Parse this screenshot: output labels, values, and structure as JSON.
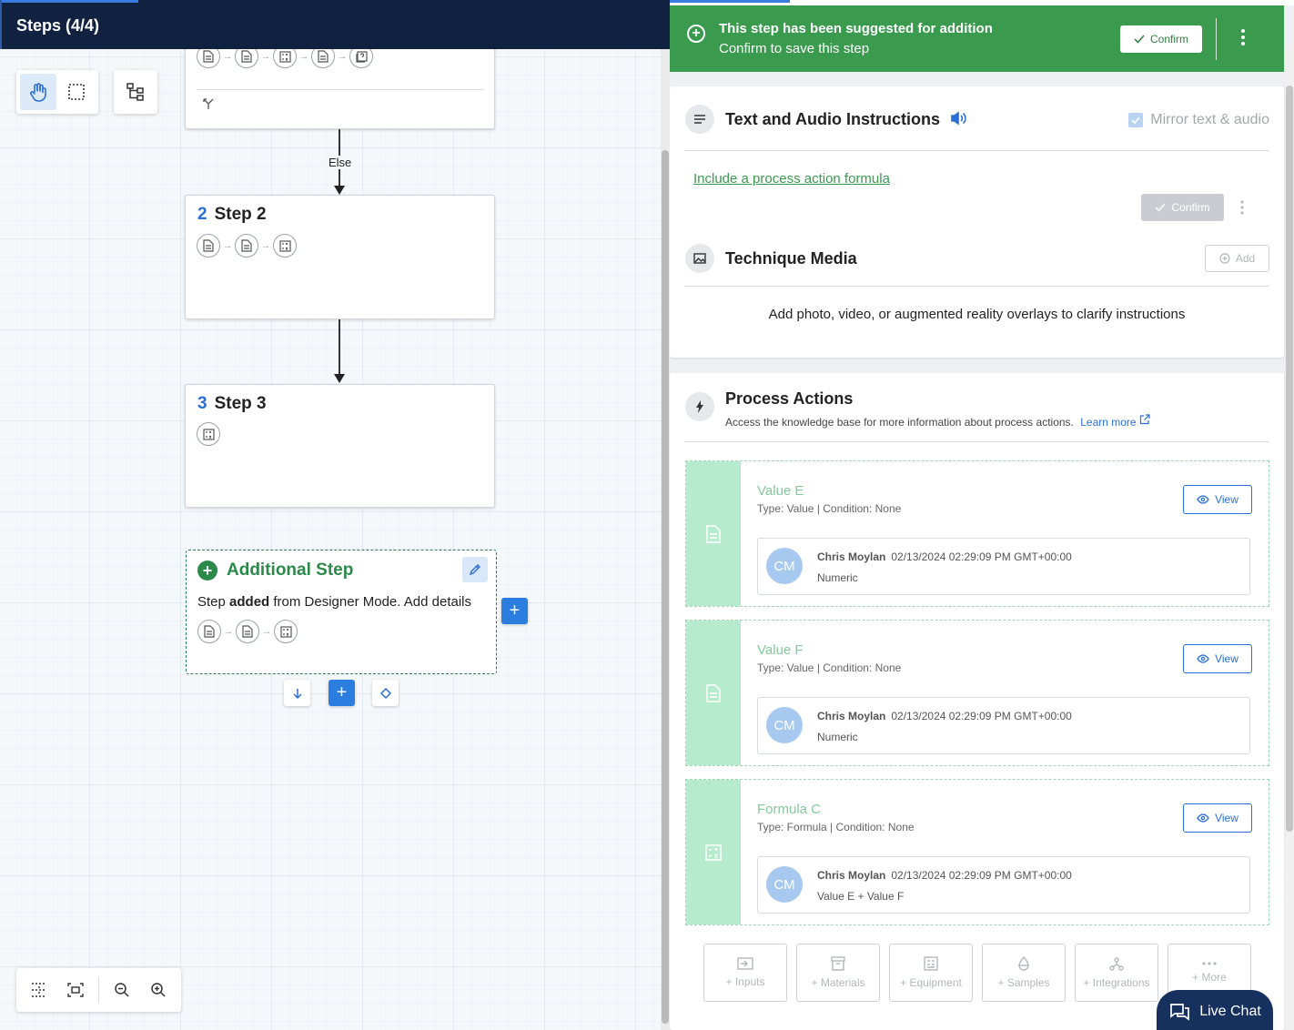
{
  "header": {
    "title": "Steps (4/4)"
  },
  "canvas": {
    "else_label": "Else",
    "steps": [
      {
        "num": "2",
        "title": "Step 2"
      },
      {
        "num": "3",
        "title": "Step 3"
      }
    ],
    "additional": {
      "title": "Additional Step",
      "desc_pre": "Step ",
      "desc_bold": "added",
      "desc_post": " from Designer Mode. Add details"
    }
  },
  "banner": {
    "title": "This step has been suggested for addition",
    "subtitle": "Confirm to save this step",
    "confirm_label": "Confirm"
  },
  "instructions": {
    "title": "Text and Audio Instructions",
    "mirror_label": "Mirror text & audio",
    "formula_link": "Include a process action formula",
    "confirm_label": "Confirm"
  },
  "media": {
    "title": "Technique Media",
    "add_label": "Add",
    "description": "Add photo, video, or augmented reality overlays to clarify instructions"
  },
  "process_actions": {
    "title": "Process Actions",
    "subtitle": "Access the knowledge base for more information about process actions.",
    "learn_more": "Learn more",
    "view_label": "View",
    "items": [
      {
        "name": "Value E",
        "type": "Type: Value | Condition: None",
        "initials": "CM",
        "author": "Chris Moylan",
        "timestamp": "02/13/2024 02:29:09 PM GMT+00:00",
        "value": "Numeric"
      },
      {
        "name": "Value F",
        "type": "Type: Value | Condition: None",
        "initials": "CM",
        "author": "Chris Moylan",
        "timestamp": "02/13/2024 02:29:09 PM GMT+00:00",
        "value": "Numeric"
      },
      {
        "name": "Formula C",
        "type": "Type: Formula | Condition: None",
        "initials": "CM",
        "author": "Chris Moylan",
        "timestamp": "02/13/2024 02:29:09 PM GMT+00:00",
        "value": "Value E + Value F"
      }
    ],
    "add_buttons": [
      "+ Inputs",
      "+ Materials",
      "+ Equipment",
      "+ Samples",
      "+ Integrations",
      "+ More"
    ]
  },
  "live_chat": {
    "label": "Live Chat"
  }
}
